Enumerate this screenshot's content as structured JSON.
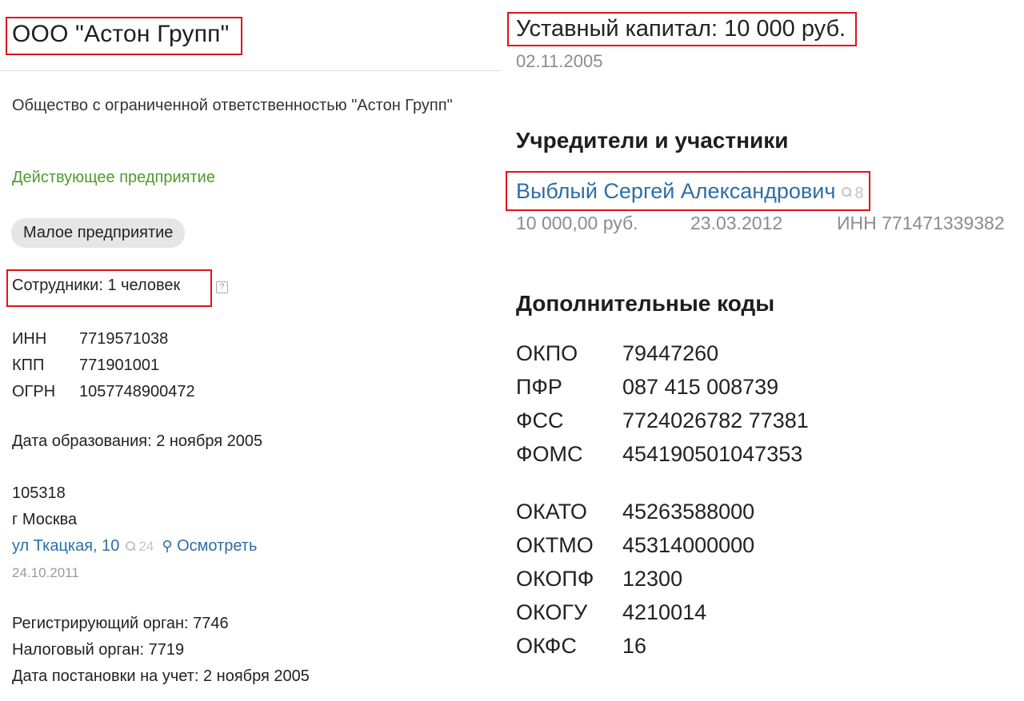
{
  "left": {
    "title": "ООО \"Астон Групп\"",
    "full_name": "Общество с ограниченной ответственностью \"Астон Групп\"",
    "status": "Действующее предприятие",
    "size_badge": "Малое предприятие",
    "employees": "Сотрудники: 1 человек",
    "help_glyph": "?",
    "codes": [
      {
        "key": "ИНН",
        "value": "7719571038"
      },
      {
        "key": "КПП",
        "value": "771901001"
      },
      {
        "key": "ОГРН",
        "value": "1057748900472"
      }
    ],
    "formation_date": "Дата образования: 2 ноября 2005",
    "address": {
      "postcode": "105318",
      "city": "г Москва",
      "street": "ул Ткацкая, 10",
      "search_count": "24",
      "inspect_link": "Осмотреть",
      "date": "24.10.2011"
    },
    "registering_body": "Регистрирующий орган: 7746",
    "tax_body": "Налоговый орган: 7719",
    "registration_date": "Дата постановки на учет: 2 ноября 2005"
  },
  "right": {
    "capital": "Уставный капитал: 10 000 руб.",
    "capital_date": "02.11.2005",
    "founders_heading": "Учредители и участники",
    "founder": {
      "name": "Выблый Сергей Александрович",
      "search_count": "8",
      "share": "10 000,00 руб.",
      "date": "23.03.2012",
      "inn": "ИНН 771471339382"
    },
    "extra_codes_heading": "Дополнительные коды",
    "codes_group1": [
      {
        "key": "ОКПО",
        "value": "79447260"
      },
      {
        "key": "ПФР",
        "value": "087 415 008739"
      },
      {
        "key": "ФСС",
        "value": "7724026782 77381"
      },
      {
        "key": "ФОМС",
        "value": "454190501047353"
      }
    ],
    "codes_group2": [
      {
        "key": "ОКАТО",
        "value": "45263588000"
      },
      {
        "key": "ОКТМО",
        "value": "45314000000"
      },
      {
        "key": "ОКОПФ",
        "value": "12300"
      },
      {
        "key": "ОКОГУ",
        "value": "4210014"
      },
      {
        "key": "ОКФС",
        "value": "16"
      }
    ]
  },
  "colors": {
    "highlight": "#e0121b",
    "link": "#2d6ea8",
    "status_green": "#4f9a2c",
    "muted": "#8c8c8c"
  }
}
